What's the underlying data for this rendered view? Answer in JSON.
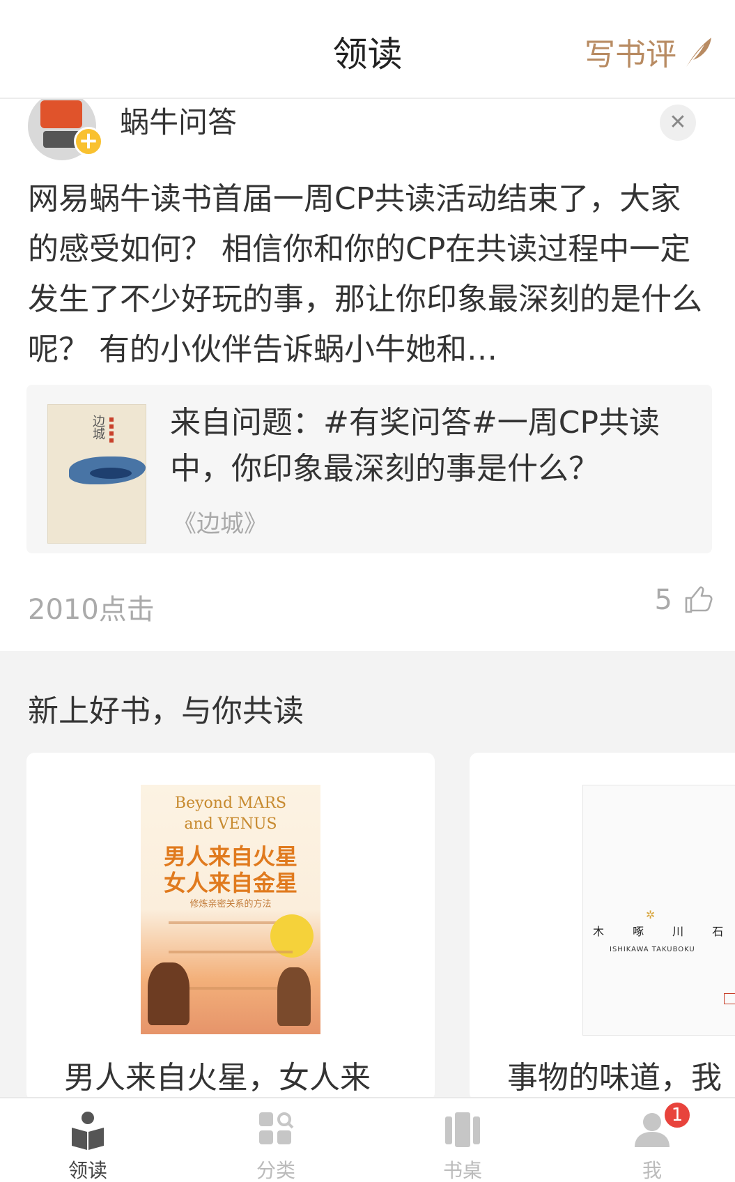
{
  "header": {
    "title": "领读",
    "write_review": "写书评"
  },
  "post": {
    "author": "蜗牛问答",
    "text": "网易蜗牛读书首届一周CP共读活动结束了，大家的感受如何？ 相信你和你的CP在共读过程中一定发生了不少好玩的事，那让你印象最深刻的是什么呢？ 有的小伙伴告诉蜗小牛她和…",
    "quote": {
      "cover_text": "边城",
      "title": "来自问题：#有奖问答#一周CP共读中，你印象最深刻的事是什么？",
      "book": "《边城》"
    },
    "clicks": "2010点击",
    "likes": "5"
  },
  "section": {
    "title": "新上好书，与你共读",
    "books": [
      {
        "title": "男人来自火星，女人来",
        "cover": {
          "en_line1": "Beyond MARS",
          "en_line2": "and VENUS",
          "cn_line1": "男人来自火星",
          "cn_line2": "女人来自金星",
          "subtitle": "修炼亲密关系的方法"
        }
      },
      {
        "title": "事物的味道，我",
        "cover": {
          "name": "木 啄 川 石",
          "roman": "ISHIKAWA TAKUBOKU"
        }
      }
    ]
  },
  "bottom_nav": {
    "items": [
      {
        "label": "领读"
      },
      {
        "label": "分类"
      },
      {
        "label": "书桌"
      },
      {
        "label": "我"
      }
    ],
    "me_badge": "1"
  },
  "colors": {
    "accent": "#b88b62",
    "badge": "#e8433c",
    "plus_badge": "#f9c130"
  }
}
